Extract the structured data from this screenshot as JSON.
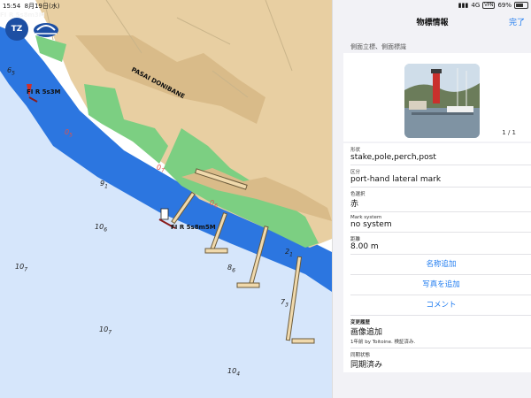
{
  "status": {
    "time": "15:54",
    "date": "8月19日(水)",
    "network": "4G",
    "vpn": "VPN",
    "battery": "69%"
  },
  "map": {
    "place_label": "PASAI DONIBANE",
    "light_labels": [
      "FI R 5s3M",
      "FI R 5s8m5M",
      "FI R 5s8m3M"
    ],
    "depths": [
      {
        "v": "6",
        "s": "5"
      },
      {
        "v": "9",
        "s": "1"
      },
      {
        "v": "10",
        "s": "6"
      },
      {
        "v": "10",
        "s": "7"
      },
      {
        "v": "8",
        "s": "6"
      },
      {
        "v": "7",
        "s": "3"
      },
      {
        "v": "10",
        "s": "7"
      },
      {
        "v": "10",
        "s": "4"
      },
      {
        "v": "2",
        "s": "1"
      },
      {
        "v": "0",
        "s": "7"
      },
      {
        "v": "0",
        "s": "6"
      },
      {
        "v": "0",
        "s": "5"
      }
    ],
    "colors": {
      "land": "#e8cfa2",
      "built": "#d9bb89",
      "green": "#7ccf82",
      "shallow": "#d6e6fb",
      "deep": "#2c76e0"
    }
  },
  "panel": {
    "title": "物標情報",
    "done_label": "完了",
    "section_header": "側面立標、側面標識",
    "photo_counter": "1 / 1",
    "fields": [
      {
        "label": "形状",
        "value": "stake,pole,perch,post"
      },
      {
        "label": "区分",
        "value": "port-hand lateral mark"
      },
      {
        "label": "色選択",
        "value": "赤"
      },
      {
        "label": "Mark system",
        "value": "no system"
      },
      {
        "label": "距離",
        "value": "8.00 m"
      }
    ],
    "actions": [
      "名称追加",
      "写真を追加",
      "コメント"
    ],
    "history": {
      "label": "変更履歴",
      "value": "画像追加",
      "sub": "1年前 by Toitoine. 検証済み."
    },
    "sync": {
      "label": "同期状態",
      "value": "同期済み"
    }
  }
}
